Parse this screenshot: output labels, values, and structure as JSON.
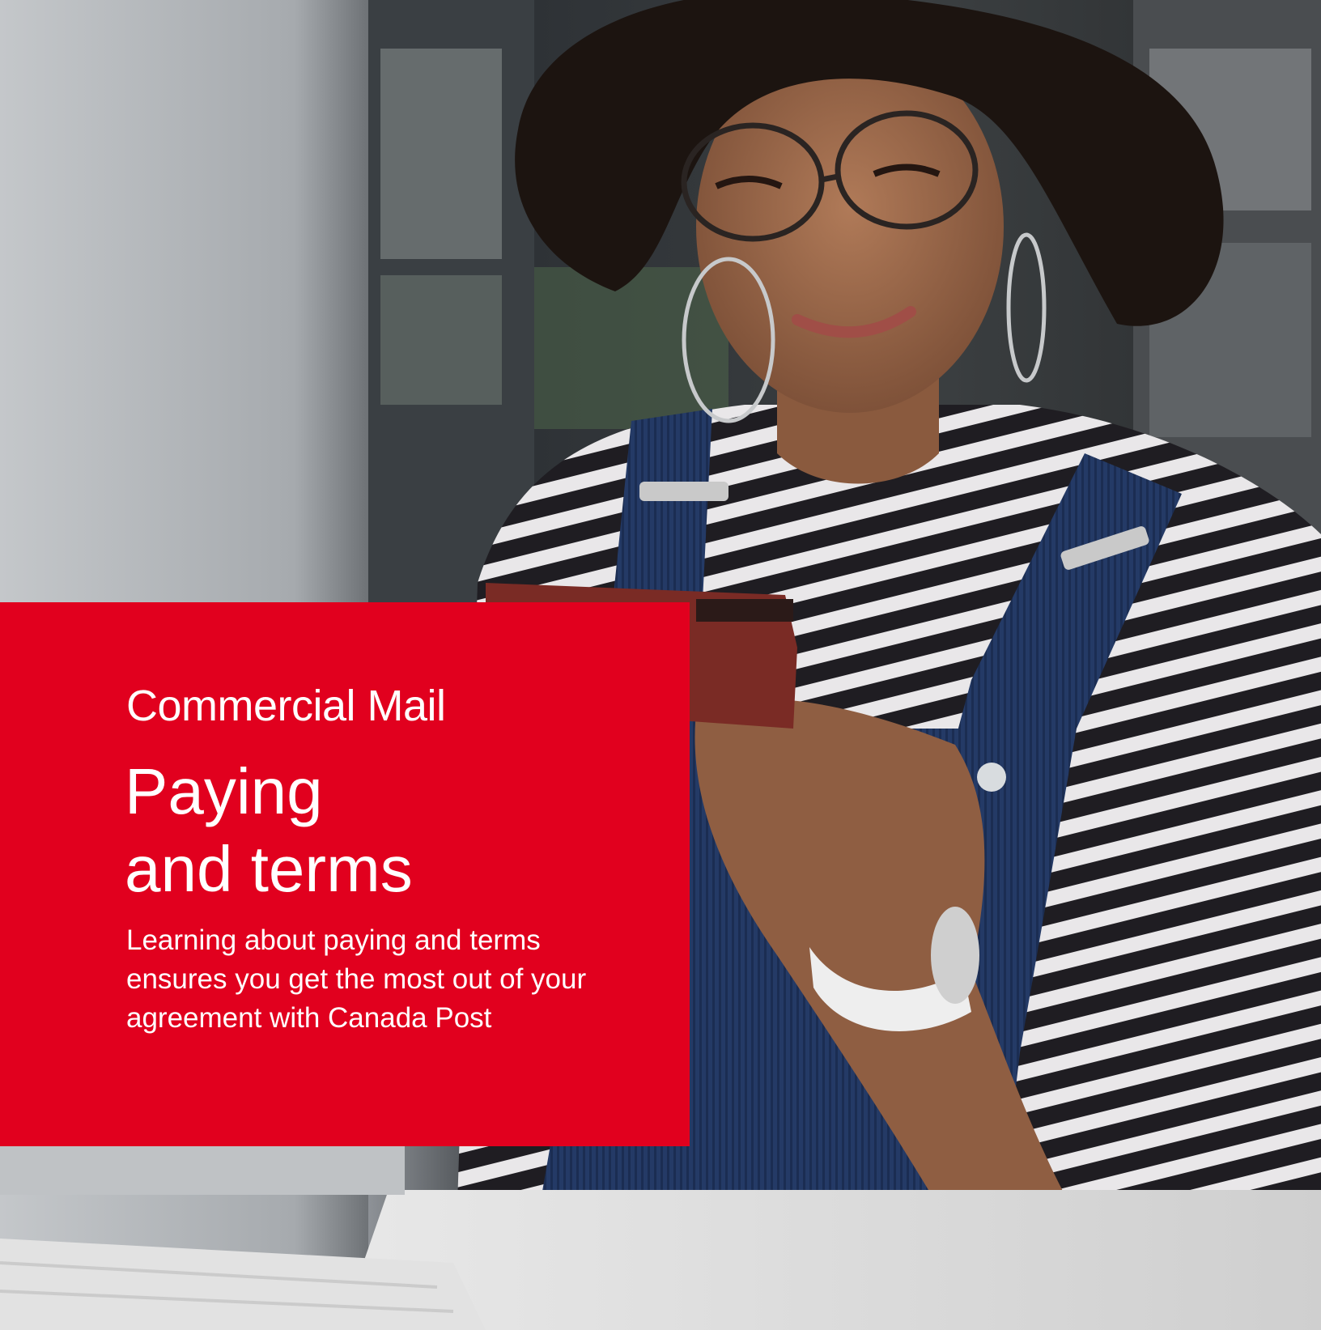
{
  "cover": {
    "eyebrow": "Commercial Mail",
    "title_lines": [
      "Paying",
      "and terms"
    ],
    "intro": "Learning about paying and terms ensures you get the most out of your agreement with Canada Post"
  },
  "colors": {
    "brand_red": "#e1001e",
    "text": "#ffffff"
  }
}
